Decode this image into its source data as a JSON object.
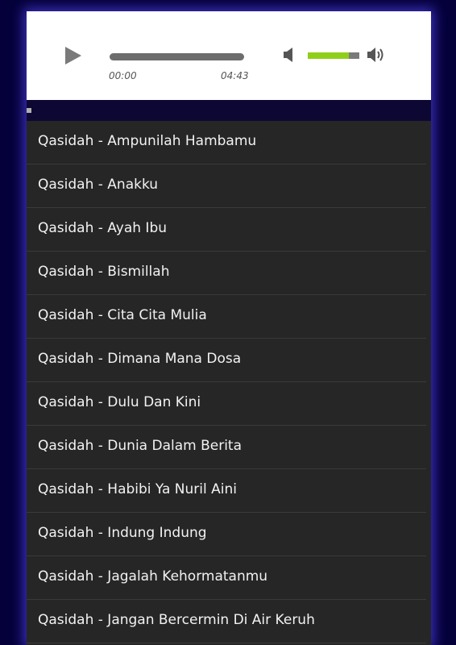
{
  "player": {
    "current_time": "00:00",
    "total_time": "04:43",
    "volume_level": 0.8,
    "accent_color": "#8fcf1a"
  },
  "playlist": [
    "Qasidah - Ampunilah Hambamu",
    "Qasidah - Anakku",
    "Qasidah - Ayah Ibu",
    "Qasidah - Bismillah",
    "Qasidah - Cita Cita Mulia",
    "Qasidah - Dimana Mana Dosa",
    "Qasidah - Dulu Dan Kini",
    "Qasidah - Dunia Dalam Berita",
    "Qasidah - Habibi Ya Nuril Aini",
    "Qasidah - Indung Indung",
    "Qasidah - Jagalah Kehormatanmu",
    "Qasidah - Jangan Bercermin Di Air Keruh"
  ]
}
